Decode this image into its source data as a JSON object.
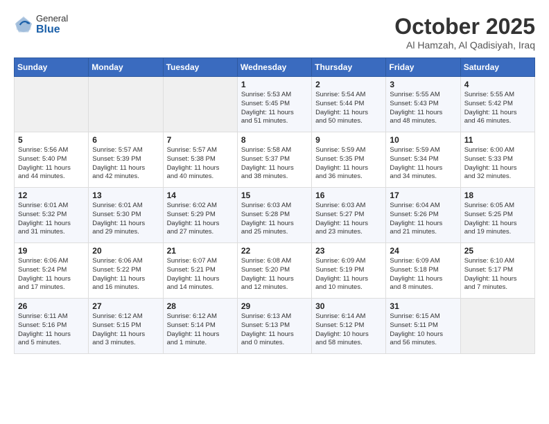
{
  "logo": {
    "general": "General",
    "blue": "Blue"
  },
  "title": "October 2025",
  "subtitle": "Al Hamzah, Al Qadisiyah, Iraq",
  "headers": [
    "Sunday",
    "Monday",
    "Tuesday",
    "Wednesday",
    "Thursday",
    "Friday",
    "Saturday"
  ],
  "weeks": [
    [
      {
        "day": "",
        "info": ""
      },
      {
        "day": "",
        "info": ""
      },
      {
        "day": "",
        "info": ""
      },
      {
        "day": "1",
        "info": "Sunrise: 5:53 AM\nSunset: 5:45 PM\nDaylight: 11 hours\nand 51 minutes."
      },
      {
        "day": "2",
        "info": "Sunrise: 5:54 AM\nSunset: 5:44 PM\nDaylight: 11 hours\nand 50 minutes."
      },
      {
        "day": "3",
        "info": "Sunrise: 5:55 AM\nSunset: 5:43 PM\nDaylight: 11 hours\nand 48 minutes."
      },
      {
        "day": "4",
        "info": "Sunrise: 5:55 AM\nSunset: 5:42 PM\nDaylight: 11 hours\nand 46 minutes."
      }
    ],
    [
      {
        "day": "5",
        "info": "Sunrise: 5:56 AM\nSunset: 5:40 PM\nDaylight: 11 hours\nand 44 minutes."
      },
      {
        "day": "6",
        "info": "Sunrise: 5:57 AM\nSunset: 5:39 PM\nDaylight: 11 hours\nand 42 minutes."
      },
      {
        "day": "7",
        "info": "Sunrise: 5:57 AM\nSunset: 5:38 PM\nDaylight: 11 hours\nand 40 minutes."
      },
      {
        "day": "8",
        "info": "Sunrise: 5:58 AM\nSunset: 5:37 PM\nDaylight: 11 hours\nand 38 minutes."
      },
      {
        "day": "9",
        "info": "Sunrise: 5:59 AM\nSunset: 5:35 PM\nDaylight: 11 hours\nand 36 minutes."
      },
      {
        "day": "10",
        "info": "Sunrise: 5:59 AM\nSunset: 5:34 PM\nDaylight: 11 hours\nand 34 minutes."
      },
      {
        "day": "11",
        "info": "Sunrise: 6:00 AM\nSunset: 5:33 PM\nDaylight: 11 hours\nand 32 minutes."
      }
    ],
    [
      {
        "day": "12",
        "info": "Sunrise: 6:01 AM\nSunset: 5:32 PM\nDaylight: 11 hours\nand 31 minutes."
      },
      {
        "day": "13",
        "info": "Sunrise: 6:01 AM\nSunset: 5:30 PM\nDaylight: 11 hours\nand 29 minutes."
      },
      {
        "day": "14",
        "info": "Sunrise: 6:02 AM\nSunset: 5:29 PM\nDaylight: 11 hours\nand 27 minutes."
      },
      {
        "day": "15",
        "info": "Sunrise: 6:03 AM\nSunset: 5:28 PM\nDaylight: 11 hours\nand 25 minutes."
      },
      {
        "day": "16",
        "info": "Sunrise: 6:03 AM\nSunset: 5:27 PM\nDaylight: 11 hours\nand 23 minutes."
      },
      {
        "day": "17",
        "info": "Sunrise: 6:04 AM\nSunset: 5:26 PM\nDaylight: 11 hours\nand 21 minutes."
      },
      {
        "day": "18",
        "info": "Sunrise: 6:05 AM\nSunset: 5:25 PM\nDaylight: 11 hours\nand 19 minutes."
      }
    ],
    [
      {
        "day": "19",
        "info": "Sunrise: 6:06 AM\nSunset: 5:24 PM\nDaylight: 11 hours\nand 17 minutes."
      },
      {
        "day": "20",
        "info": "Sunrise: 6:06 AM\nSunset: 5:22 PM\nDaylight: 11 hours\nand 16 minutes."
      },
      {
        "day": "21",
        "info": "Sunrise: 6:07 AM\nSunset: 5:21 PM\nDaylight: 11 hours\nand 14 minutes."
      },
      {
        "day": "22",
        "info": "Sunrise: 6:08 AM\nSunset: 5:20 PM\nDaylight: 11 hours\nand 12 minutes."
      },
      {
        "day": "23",
        "info": "Sunrise: 6:09 AM\nSunset: 5:19 PM\nDaylight: 11 hours\nand 10 minutes."
      },
      {
        "day": "24",
        "info": "Sunrise: 6:09 AM\nSunset: 5:18 PM\nDaylight: 11 hours\nand 8 minutes."
      },
      {
        "day": "25",
        "info": "Sunrise: 6:10 AM\nSunset: 5:17 PM\nDaylight: 11 hours\nand 7 minutes."
      }
    ],
    [
      {
        "day": "26",
        "info": "Sunrise: 6:11 AM\nSunset: 5:16 PM\nDaylight: 11 hours\nand 5 minutes."
      },
      {
        "day": "27",
        "info": "Sunrise: 6:12 AM\nSunset: 5:15 PM\nDaylight: 11 hours\nand 3 minutes."
      },
      {
        "day": "28",
        "info": "Sunrise: 6:12 AM\nSunset: 5:14 PM\nDaylight: 11 hours\nand 1 minute."
      },
      {
        "day": "29",
        "info": "Sunrise: 6:13 AM\nSunset: 5:13 PM\nDaylight: 11 hours\nand 0 minutes."
      },
      {
        "day": "30",
        "info": "Sunrise: 6:14 AM\nSunset: 5:12 PM\nDaylight: 10 hours\nand 58 minutes."
      },
      {
        "day": "31",
        "info": "Sunrise: 6:15 AM\nSunset: 5:11 PM\nDaylight: 10 hours\nand 56 minutes."
      },
      {
        "day": "",
        "info": ""
      }
    ]
  ]
}
